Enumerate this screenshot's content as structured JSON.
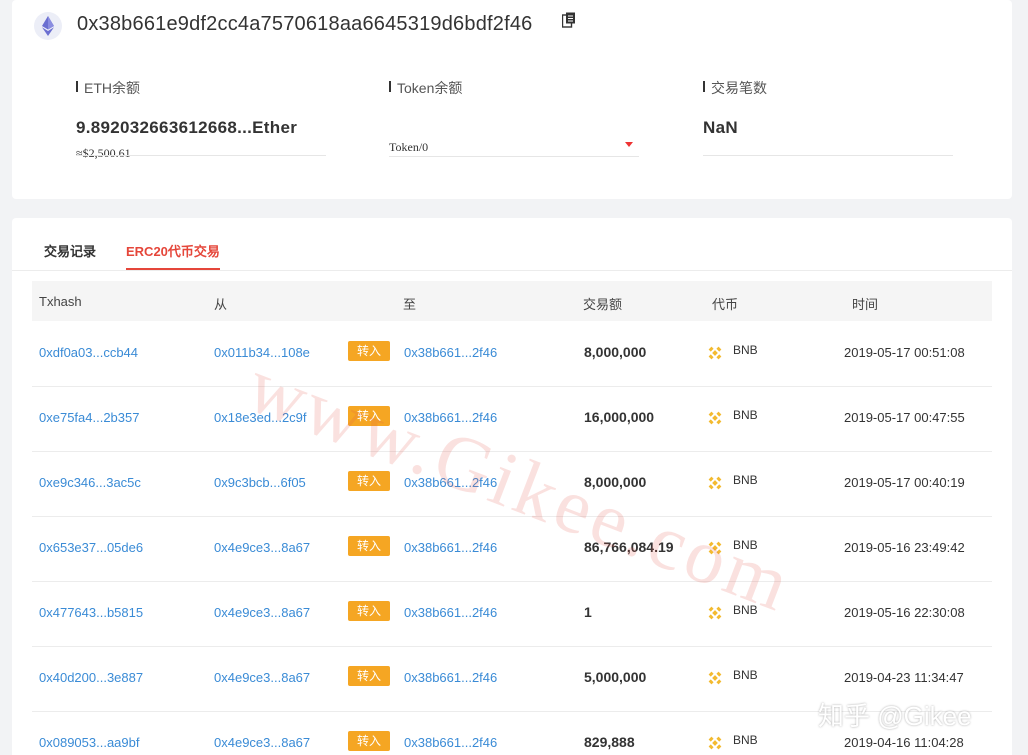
{
  "header": {
    "address": "0x38b661e9df2cc4a7570618aa6645319d6bdf2f46"
  },
  "stats": {
    "eth": {
      "label": "ETH余额",
      "value": "9.892032663612668...Ether",
      "usd": "≈$2,500.61"
    },
    "token": {
      "label": "Token余额",
      "selected": "Token/0"
    },
    "tx": {
      "label": "交易笔数",
      "value": "NaN"
    }
  },
  "tabs": [
    {
      "label": "交易记录",
      "active": false
    },
    {
      "label": "ERC20代币交易",
      "active": true
    }
  ],
  "table": {
    "headers": [
      "Txhash",
      "从",
      "至",
      "交易额",
      "代币",
      "时间"
    ],
    "rows": [
      {
        "hash": "0xdf0a03...ccb44",
        "from": "0x011b34...108e",
        "dir": "转入",
        "to": "0x38b661...2f46",
        "amount": "8,000,000",
        "token": "BNB",
        "time": "2019-05-17 00:51:08"
      },
      {
        "hash": "0xe75fa4...2b357",
        "from": "0x18e3ed...2c9f",
        "dir": "转入",
        "to": "0x38b661...2f46",
        "amount": "16,000,000",
        "token": "BNB",
        "time": "2019-05-17 00:47:55"
      },
      {
        "hash": "0xe9c346...3ac5c",
        "from": "0x9c3bcb...6f05",
        "dir": "转入",
        "to": "0x38b661...2f46",
        "amount": "8,000,000",
        "token": "BNB",
        "time": "2019-05-17 00:40:19"
      },
      {
        "hash": "0x653e37...05de6",
        "from": "0x4e9ce3...8a67",
        "dir": "转入",
        "to": "0x38b661...2f46",
        "amount": "86,766,084.19",
        "token": "BNB",
        "time": "2019-05-16 23:49:42"
      },
      {
        "hash": "0x477643...b5815",
        "from": "0x4e9ce3...8a67",
        "dir": "转入",
        "to": "0x38b661...2f46",
        "amount": "1",
        "token": "BNB",
        "time": "2019-05-16 22:30:08"
      },
      {
        "hash": "0x40d200...3e887",
        "from": "0x4e9ce3...8a67",
        "dir": "转入",
        "to": "0x38b661...2f46",
        "amount": "5,000,000",
        "token": "BNB",
        "time": "2019-04-23 11:34:47"
      },
      {
        "hash": "0x089053...aa9bf",
        "from": "0x4e9ce3...8a67",
        "dir": "转入",
        "to": "0x38b661...2f46",
        "amount": "829,888",
        "token": "BNB",
        "time": "2019-04-16 11:04:28"
      }
    ]
  },
  "watermarks": {
    "site": "www.Gikee.com",
    "zhihu": "知乎 @Gikee"
  },
  "colors": {
    "accent": "#e5463a",
    "link": "#3a8bd6",
    "badge": "#f5a623",
    "bnb": "#f3ba2f"
  },
  "icons": {
    "eth": "ethereum-icon",
    "copy": "copy-icon",
    "token": "bnb-icon",
    "caret": "caret-down-icon"
  }
}
